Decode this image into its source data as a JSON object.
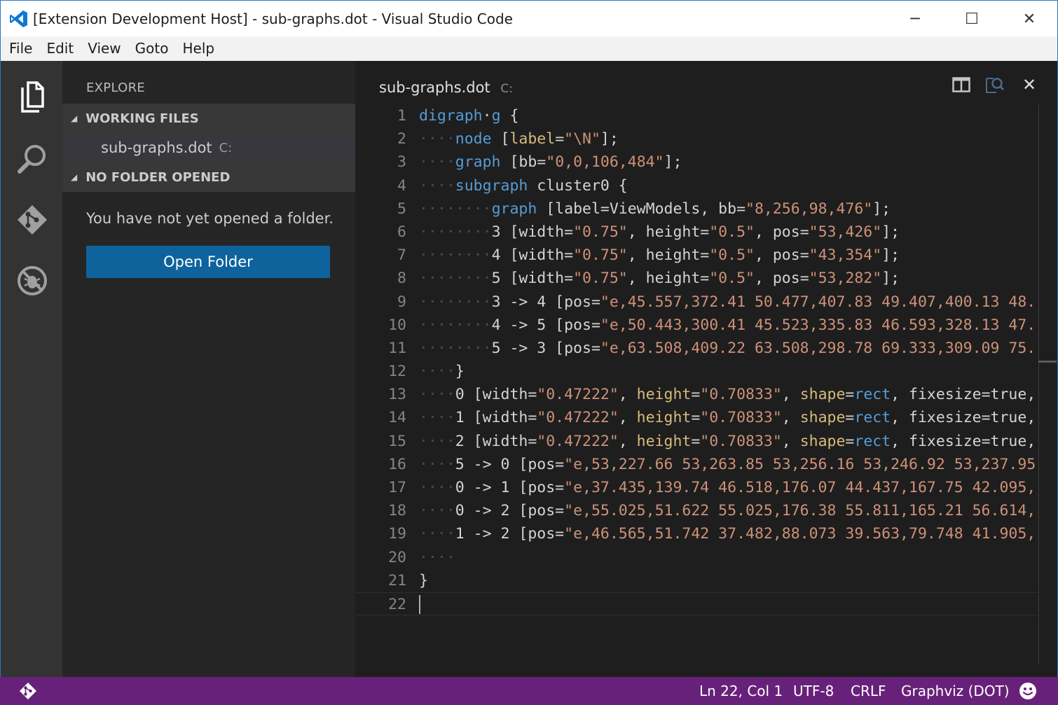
{
  "window": {
    "title": "[Extension Development Host] - sub-graphs.dot - Visual Studio Code",
    "minimize": "─",
    "maximize": "☐",
    "close": "✕"
  },
  "menu": [
    "File",
    "Edit",
    "View",
    "Goto",
    "Help"
  ],
  "activity_bar": {
    "icons": [
      "explore-icon",
      "search-icon",
      "git-icon",
      "debug-icon"
    ]
  },
  "sidebar": {
    "title": "EXPLORE",
    "working_files": {
      "header": "WORKING FILES",
      "caret": "◢",
      "file": {
        "name": "sub-graphs.dot",
        "path": "C:"
      }
    },
    "no_folder": {
      "header": "NO FOLDER OPENED",
      "caret": "◢",
      "message": "You have not yet opened a folder.",
      "button": "Open Folder"
    }
  },
  "editor": {
    "tab": {
      "name": "sub-graphs.dot",
      "path": "C:"
    },
    "actions": [
      "split-editor-icon",
      "open-change-icon",
      "close-icon"
    ],
    "close_glyph": "✕",
    "current_line": 22,
    "lines": [
      {
        "n": "1",
        "tokens": [
          [
            "kw",
            "digraph"
          ],
          [
            "",
            "·"
          ],
          [
            "kw",
            "g"
          ],
          [
            "",
            " {"
          ]
        ]
      },
      {
        "n": "2",
        "tokens": [
          [
            "ws",
            "····"
          ],
          [
            "kw",
            "node"
          ],
          [
            "",
            " ["
          ],
          [
            "attr",
            "label"
          ],
          [
            "",
            "="
          ],
          [
            "str",
            "\"\\N\""
          ],
          [
            "",
            "];"
          ]
        ]
      },
      {
        "n": "3",
        "tokens": [
          [
            "ws",
            "····"
          ],
          [
            "kw",
            "graph"
          ],
          [
            "",
            " [bb="
          ],
          [
            "str",
            "\"0,0,106,484\""
          ],
          [
            "",
            "];"
          ]
        ]
      },
      {
        "n": "4",
        "tokens": [
          [
            "ws",
            "····"
          ],
          [
            "kw",
            "subgraph"
          ],
          [
            "",
            " cluster0 {"
          ]
        ]
      },
      {
        "n": "5",
        "tokens": [
          [
            "ws",
            "········"
          ],
          [
            "kw",
            "graph"
          ],
          [
            "",
            " [label=ViewModels, bb="
          ],
          [
            "str",
            "\"8,256,98,476\""
          ],
          [
            "",
            "];"
          ]
        ]
      },
      {
        "n": "6",
        "tokens": [
          [
            "ws",
            "········"
          ],
          [
            "",
            "3 [width="
          ],
          [
            "str",
            "\"0.75\""
          ],
          [
            "",
            ", height="
          ],
          [
            "str",
            "\"0.5\""
          ],
          [
            "",
            ", pos="
          ],
          [
            "str",
            "\"53,426\""
          ],
          [
            "",
            "];"
          ]
        ]
      },
      {
        "n": "7",
        "tokens": [
          [
            "ws",
            "········"
          ],
          [
            "",
            "4 [width="
          ],
          [
            "str",
            "\"0.75\""
          ],
          [
            "",
            ", height="
          ],
          [
            "str",
            "\"0.5\""
          ],
          [
            "",
            ", pos="
          ],
          [
            "str",
            "\"43,354\""
          ],
          [
            "",
            "];"
          ]
        ]
      },
      {
        "n": "8",
        "tokens": [
          [
            "ws",
            "········"
          ],
          [
            "",
            "5 [width="
          ],
          [
            "str",
            "\"0.75\""
          ],
          [
            "",
            ", height="
          ],
          [
            "str",
            "\"0.5\""
          ],
          [
            "",
            ", pos="
          ],
          [
            "str",
            "\"53,282\""
          ],
          [
            "",
            "];"
          ]
        ]
      },
      {
        "n": "9",
        "tokens": [
          [
            "ws",
            "········"
          ],
          [
            "",
            "3 -> 4 [pos="
          ],
          [
            "str",
            "\"e,45.557,372.41 50.477,407.83 49.407,400.13 48."
          ]
        ]
      },
      {
        "n": "10",
        "tokens": [
          [
            "ws",
            "········"
          ],
          [
            "",
            "4 -> 5 [pos="
          ],
          [
            "str",
            "\"e,50.443,300.41 45.523,335.83 46.593,328.13 47."
          ]
        ]
      },
      {
        "n": "11",
        "tokens": [
          [
            "ws",
            "········"
          ],
          [
            "",
            "5 -> 3 [pos="
          ],
          [
            "str",
            "\"e,63.508,409.22 63.508,298.78 69.333,309.09 75."
          ]
        ]
      },
      {
        "n": "12",
        "tokens": [
          [
            "ws",
            "····"
          ],
          [
            "",
            "}"
          ]
        ]
      },
      {
        "n": "13",
        "tokens": [
          [
            "ws",
            "····"
          ],
          [
            "",
            "0 [width="
          ],
          [
            "str",
            "\"0.47222\""
          ],
          [
            "",
            ", "
          ],
          [
            "attr",
            "height"
          ],
          [
            "",
            "="
          ],
          [
            "str",
            "\"0.70833\""
          ],
          [
            "",
            ", "
          ],
          [
            "attr",
            "shape"
          ],
          [
            "",
            "="
          ],
          [
            "kw",
            "rect"
          ],
          [
            "",
            ", fixesize=true,"
          ]
        ]
      },
      {
        "n": "14",
        "tokens": [
          [
            "ws",
            "····"
          ],
          [
            "",
            "1 [width="
          ],
          [
            "str",
            "\"0.47222\""
          ],
          [
            "",
            ", "
          ],
          [
            "attr",
            "height"
          ],
          [
            "",
            "="
          ],
          [
            "str",
            "\"0.70833\""
          ],
          [
            "",
            ", "
          ],
          [
            "attr",
            "shape"
          ],
          [
            "",
            "="
          ],
          [
            "kw",
            "rect"
          ],
          [
            "",
            ", fixesize=true,"
          ]
        ]
      },
      {
        "n": "15",
        "tokens": [
          [
            "ws",
            "····"
          ],
          [
            "",
            "2 [width="
          ],
          [
            "str",
            "\"0.47222\""
          ],
          [
            "",
            ", "
          ],
          [
            "attr",
            "height"
          ],
          [
            "",
            "="
          ],
          [
            "str",
            "\"0.70833\""
          ],
          [
            "",
            ", "
          ],
          [
            "attr",
            "shape"
          ],
          [
            "",
            "="
          ],
          [
            "kw",
            "rect"
          ],
          [
            "",
            ", fixesize=true,"
          ]
        ]
      },
      {
        "n": "16",
        "tokens": [
          [
            "ws",
            "····"
          ],
          [
            "",
            "5 -> 0 [pos="
          ],
          [
            "str",
            "\"e,53,227.66 53,263.85 53,256.16 53,246.92 53,237.95"
          ]
        ]
      },
      {
        "n": "17",
        "tokens": [
          [
            "ws",
            "····"
          ],
          [
            "",
            "0 -> 1 [pos="
          ],
          [
            "str",
            "\"e,37.435,139.74 46.518,176.07 44.437,167.75 42.095,"
          ]
        ]
      },
      {
        "n": "18",
        "tokens": [
          [
            "ws",
            "····"
          ],
          [
            "",
            "0 -> 2 [pos="
          ],
          [
            "str",
            "\"e,55.025,51.622 55.025,176.38 55.811,165.21 56.614,"
          ]
        ]
      },
      {
        "n": "19",
        "tokens": [
          [
            "ws",
            "····"
          ],
          [
            "",
            "1 -> 2 [pos="
          ],
          [
            "str",
            "\"e,46.565,51.742 37.482,88.073 39.563,79.748 41.905,"
          ]
        ]
      },
      {
        "n": "20",
        "tokens": [
          [
            "ws",
            "····"
          ]
        ]
      },
      {
        "n": "21",
        "tokens": [
          [
            "",
            "}"
          ]
        ]
      },
      {
        "n": "22",
        "tokens": []
      }
    ]
  },
  "status_bar": {
    "branch_icon": "git-branch-icon",
    "position": "Ln 22, Col 1",
    "encoding": "UTF-8",
    "eol": "CRLF",
    "language": "Graphviz (DOT)",
    "feedback_icon": "smiley-icon",
    "color": "#68217a"
  },
  "colors": {
    "keyword": "#569cd6",
    "string": "#ce9178",
    "attribute": "#d7ba7d",
    "accent": "#0e639c"
  }
}
